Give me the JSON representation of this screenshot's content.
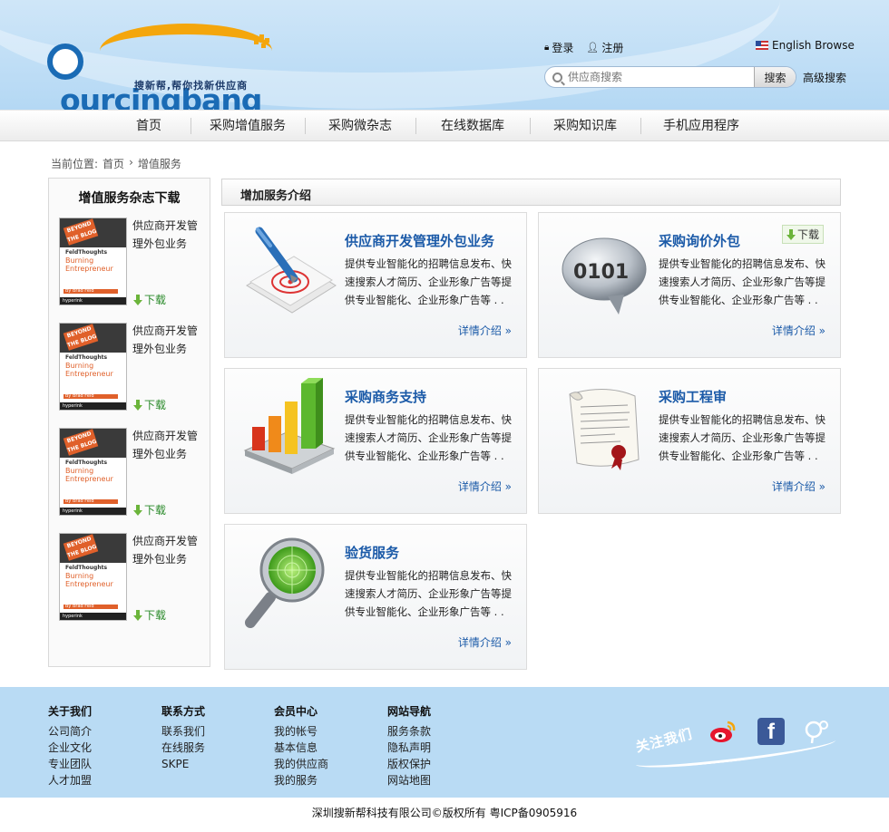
{
  "header": {
    "logo_main": "ourcingbang",
    "logo_sub": "搜新帮,帮你找新供应商",
    "login": "登录",
    "register": "注册",
    "english": "English Browse",
    "search_placeholder": "供应商搜索",
    "search_button": "搜索",
    "advanced_search": "高级搜索"
  },
  "nav": [
    {
      "label": "首页"
    },
    {
      "label": "采购增值服务"
    },
    {
      "label": "采购微杂志"
    },
    {
      "label": "在线数据库"
    },
    {
      "label": "采购知识库"
    },
    {
      "label": "手机应用程序"
    }
  ],
  "breadcrumb": {
    "prefix": "当前位置:",
    "home": "首页",
    "sep": "›",
    "current": "增值服务"
  },
  "sidebar": {
    "title": "增值服务杂志下载",
    "magazine_cover": {
      "tag": "BEYOND THE BLOG",
      "brand": "FeldThoughts",
      "headline": "Burning Entrepreneur",
      "author": "By Brad Feld",
      "publisher": "hyperink"
    },
    "items": [
      {
        "title": "供应商开发管理外包业务",
        "download": "下载"
      },
      {
        "title": "供应商开发管理外包业务",
        "download": "下载"
      },
      {
        "title": "供应商开发管理外包业务",
        "download": "下载"
      },
      {
        "title": "供应商开发管理外包业务",
        "download": "下载"
      }
    ]
  },
  "main": {
    "title": "增加服务介绍",
    "cards": [
      {
        "title": "供应商开发管理外包业务",
        "desc": "提供专业智能化的招聘信息发布、快速搜索人才简历、企业形象广告等提供专业智能化、企业形象广告等 . .",
        "more": "详情介绍",
        "icon": "pen-target-icon"
      },
      {
        "title": "采购询价外包",
        "desc": "提供专业智能化的招聘信息发布、快速搜索人才简历、企业形象广告等提供专业智能化、企业形象广告等 . .",
        "more": "详情介绍",
        "download": "下载",
        "icon": "binary-bubble-icon"
      },
      {
        "title": "采购商务支持",
        "desc": "提供专业智能化的招聘信息发布、快速搜索人才简历、企业形象广告等提供专业智能化、企业形象广告等 . .",
        "more": "详情介绍",
        "icon": "bar-chart-icon"
      },
      {
        "title": "采购工程审",
        "desc": "提供专业智能化的招聘信息发布、快速搜索人才简历、企业形象广告等提供专业智能化、企业形象广告等 . .",
        "more": "详情介绍",
        "icon": "document-seal-icon"
      },
      {
        "title": "验货服务",
        "desc": "提供专业智能化的招聘信息发布、快速搜索人才简历、企业形象广告等提供专业智能化、企业形象广告等 . .",
        "more": "详情介绍",
        "icon": "magnifier-radar-icon"
      }
    ]
  },
  "footer": {
    "columns": [
      {
        "title": "关于我们",
        "links": [
          "公司简介",
          "企业文化",
          "专业团队",
          "人才加盟"
        ]
      },
      {
        "title": "联系方式",
        "links": [
          "联系我们",
          "在线服务",
          "SKPE"
        ]
      },
      {
        "title": "会员中心",
        "links": [
          "我的帐号",
          "基本信息",
          "我的供应商",
          "我的服务"
        ]
      },
      {
        "title": "网站导航",
        "links": [
          "服务条款",
          "隐私声明",
          "版权保护",
          "网站地图"
        ]
      }
    ],
    "follow": "关注我们",
    "facebook_letter": "f",
    "copyright": "深圳搜新帮科技有限公司©版权所有 粤ICP备0905916"
  },
  "colors": {
    "brand_blue": "#1a6bb5",
    "brand_orange": "#f4a60c",
    "link_blue": "#1b5aa8",
    "footer_bg": "#b9dbf4",
    "download_green": "#6bb43a"
  }
}
